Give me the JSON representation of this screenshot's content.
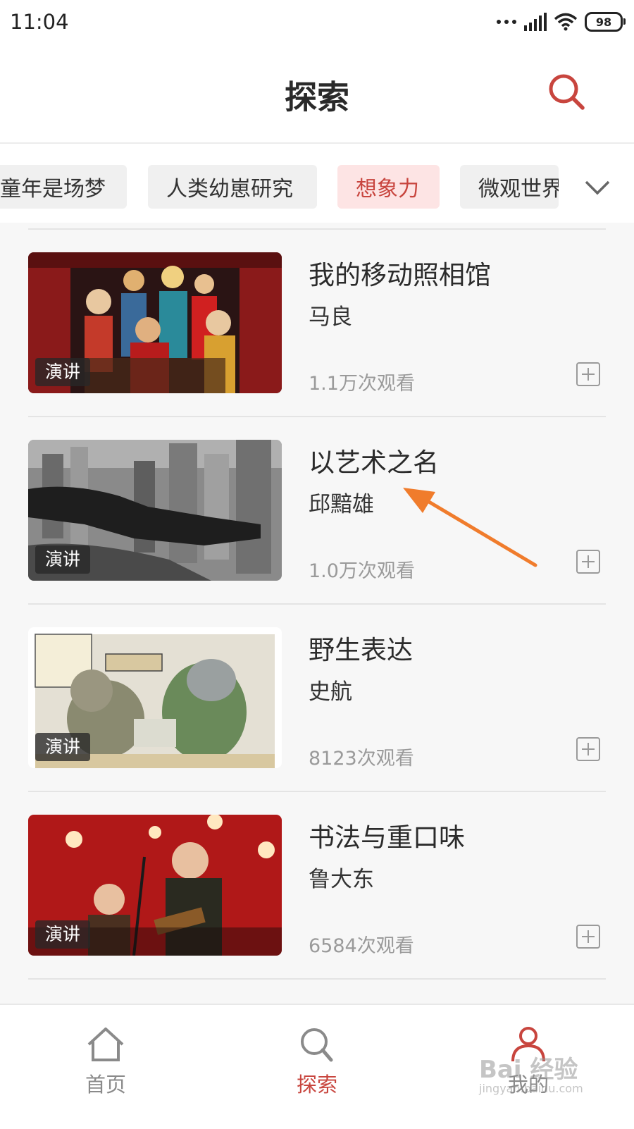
{
  "status_bar": {
    "time": "11:04",
    "battery": "98"
  },
  "header": {
    "title": "探索"
  },
  "tabs": [
    {
      "label": "童年是场梦",
      "active": false
    },
    {
      "label": "人类幼崽研究",
      "active": false
    },
    {
      "label": "想象力",
      "active": true
    },
    {
      "label": "微观世界",
      "active": false
    }
  ],
  "items": [
    {
      "title": "我的移动照相馆",
      "author": "马良",
      "views": "1.1万次观看",
      "badge": "演讲"
    },
    {
      "title": "以艺术之名",
      "author": "邱黯雄",
      "views": "1.0万次观看",
      "badge": "演讲"
    },
    {
      "title": "野生表达",
      "author": "史航",
      "views": "8123次观看",
      "badge": "演讲"
    },
    {
      "title": "书法与重口味",
      "author": "鲁大东",
      "views": "6584次观看",
      "badge": "演讲"
    }
  ],
  "bottom_nav": [
    {
      "label": "首页",
      "icon": "home-icon",
      "active": false
    },
    {
      "label": "探索",
      "icon": "search-icon",
      "active": true
    },
    {
      "label": "我的",
      "icon": "user-icon",
      "active": false
    }
  ],
  "watermark": {
    "main": "Bai 经验",
    "sub": "jingyan.baidu.com"
  },
  "colors": {
    "accent": "#c8453e",
    "arrow": "#f07c2c"
  }
}
